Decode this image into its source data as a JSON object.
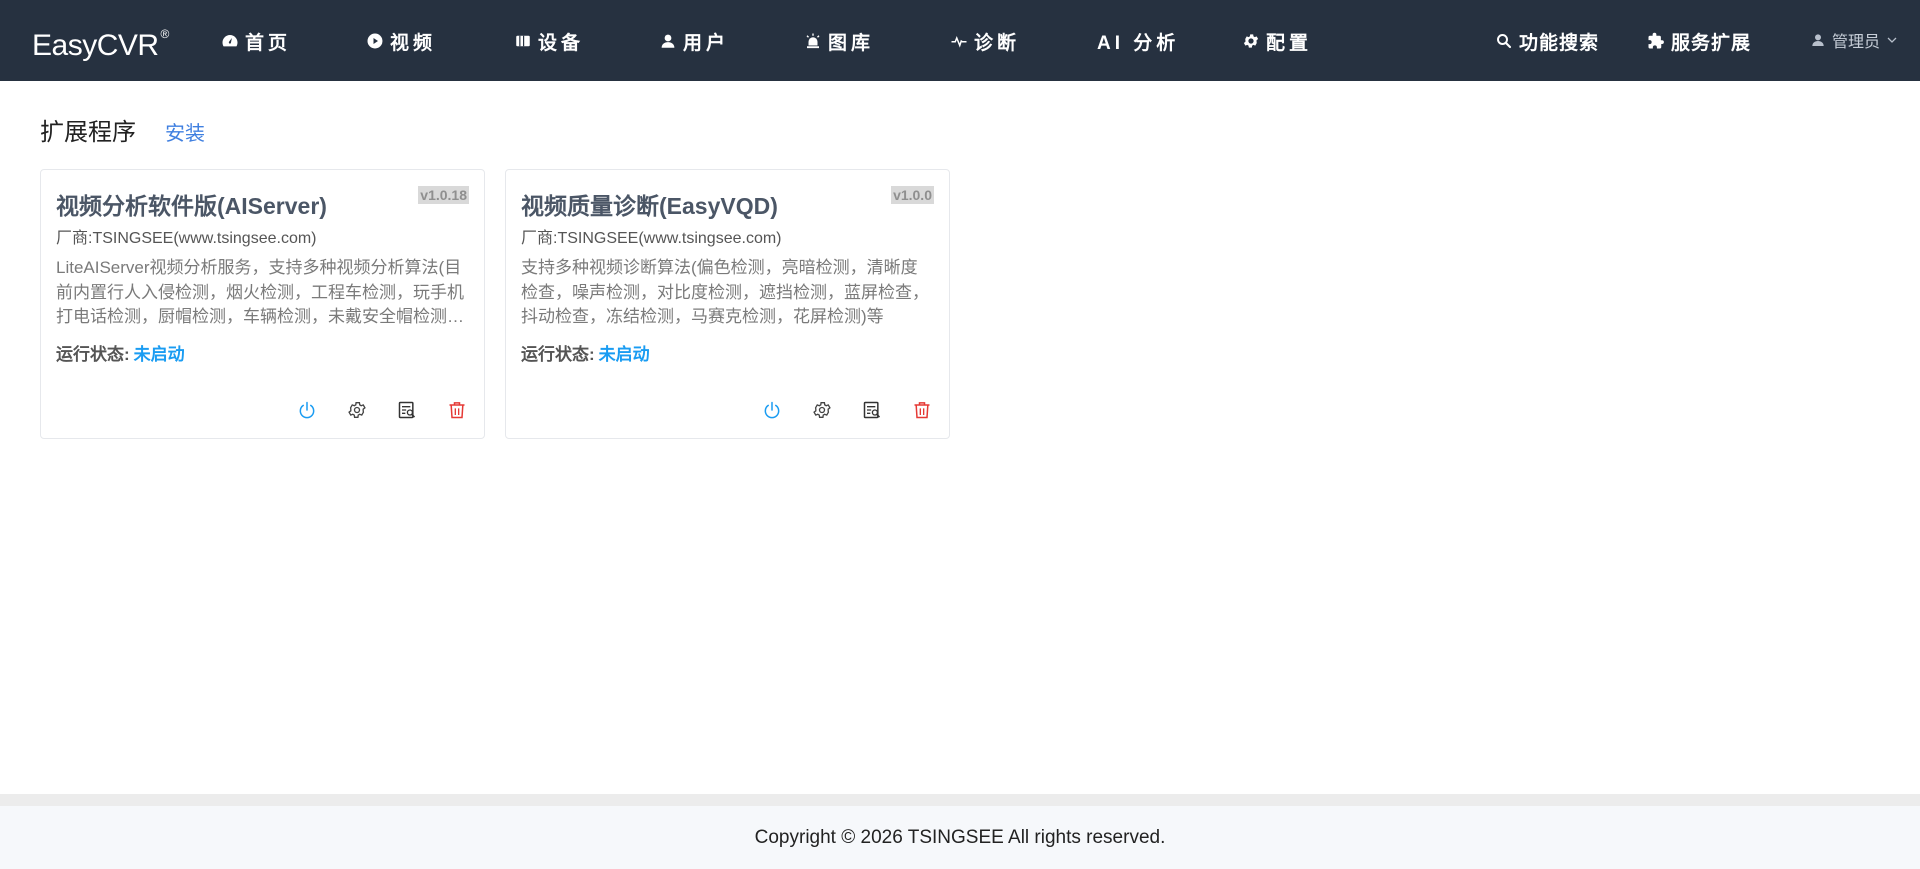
{
  "brand": {
    "name": "EasyCVR",
    "mark": "®"
  },
  "nav": {
    "items": [
      {
        "label": "首页",
        "icon": "dashboard-icon"
      },
      {
        "label": "视频",
        "icon": "play-circle-icon"
      },
      {
        "label": "设备",
        "icon": "device-icon"
      },
      {
        "label": "用户",
        "icon": "user-icon"
      },
      {
        "label": "图库",
        "icon": "alarm-light-icon"
      },
      {
        "label": "诊断",
        "icon": "pulse-icon"
      },
      {
        "label": "AI 分析",
        "icon": ""
      },
      {
        "label": "配置",
        "icon": "gear-icon"
      }
    ],
    "right_items": [
      {
        "label": "功能搜索",
        "icon": "search-icon"
      },
      {
        "label": "服务扩展",
        "icon": "puzzle-icon"
      }
    ],
    "user": {
      "label": "管理员",
      "icon": "user-icon",
      "caret": "chevron-down-icon"
    }
  },
  "page": {
    "title": "扩展程序",
    "install_label": "安装"
  },
  "plugins": [
    {
      "title": "视频分析软件版(AIServer)",
      "version": "v1.0.18",
      "vendor": "厂商:TSINGSEE(www.tsingsee.com)",
      "description": "LiteAIServer视频分析服务，支持多种视频分析算法(目前内置行人入侵检测，烟火检测，工程车检测，玩手机打电话检测，厨帽检测，车辆检测，未戴安全帽检测等)",
      "status_label": "运行状态:",
      "status_value": "未启动"
    },
    {
      "title": "视频质量诊断(EasyVQD)",
      "version": "v1.0.0",
      "vendor": "厂商:TSINGSEE(www.tsingsee.com)",
      "description": "支持多种视频诊断算法(偏色检测，亮暗检测，清晰度检查，噪声检测，对比度检测，遮挡检测，蓝屏检查，抖动检查，冻结检测，马赛克检测，花屏检测)等",
      "status_label": "运行状态:",
      "status_value": "未启动"
    }
  ],
  "card_actions": [
    "power-icon",
    "gear-icon",
    "log-icon",
    "trash-icon"
  ],
  "colors": {
    "topbar": "#263140",
    "link": "#3f7fe0",
    "status": "#1a9cf2",
    "power": "#1a9cf2",
    "delete": "#e53935"
  },
  "footer": {
    "text": "Copyright © 2026 TSINGSEE All rights reserved."
  }
}
